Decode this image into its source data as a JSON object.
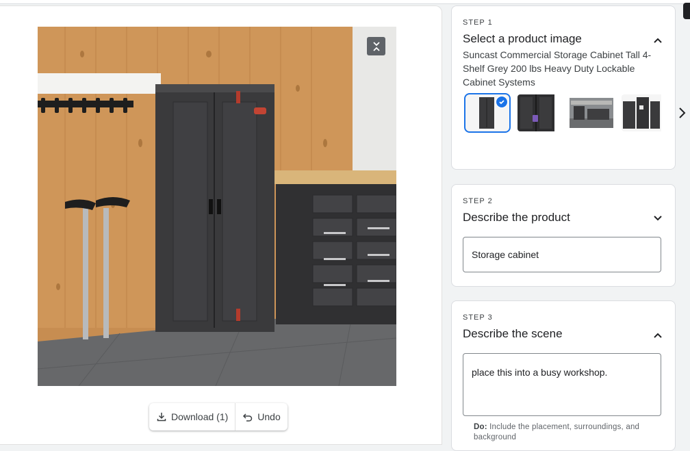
{
  "canvas": {
    "download_label": "Download (1)",
    "undo_label": "Undo",
    "collapse_icon": "collapse-arrows-icon"
  },
  "step1": {
    "label": "STEP 1",
    "title": "Select a product image",
    "product_name": "Suncast Commercial Storage Cabinet Tall 4-Shelf Grey 200 lbs Heavy Duty Lockable Cabinet Systems",
    "thumbnails": [
      "tall-cabinet-thumbnail",
      "cabinet-with-lock-thumbnail",
      "workshop-scene-thumbnail",
      "cabinet-set-thumbnail"
    ],
    "selected_index": 0
  },
  "step2": {
    "label": "STEP 2",
    "title": "Describe the product",
    "input_value": "Storage cabinet"
  },
  "step3": {
    "label": "STEP 3",
    "title": "Describe the scene",
    "textarea_value": "place this into a busy workshop.",
    "hint_prefix": "Do:",
    "hint_text": " Include the placement, surroundings, and background"
  },
  "colors": {
    "accent": "#1a73e8",
    "wood": "#c58a4c",
    "cabinet": "#3a3a3c"
  }
}
